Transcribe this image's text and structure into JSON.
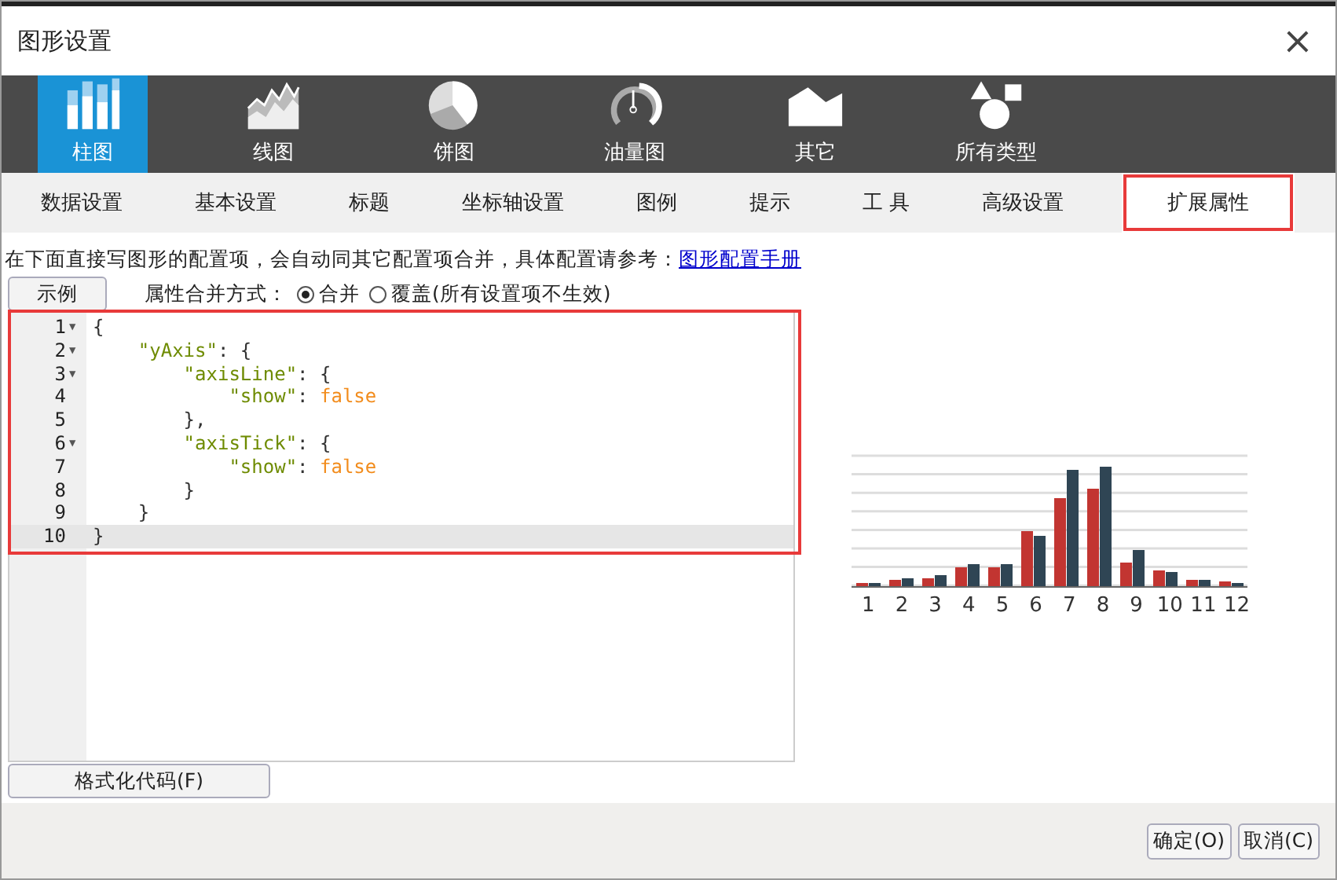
{
  "window": {
    "title": "图形设置",
    "close": "×"
  },
  "chart_types": [
    {
      "label": "柱图",
      "selected": true
    },
    {
      "label": "线图",
      "selected": false
    },
    {
      "label": "饼图",
      "selected": false
    },
    {
      "label": "油量图",
      "selected": false
    },
    {
      "label": "其它",
      "selected": false
    },
    {
      "label": "所有类型",
      "selected": false
    }
  ],
  "tabs": [
    {
      "label": "数据设置",
      "selected": false
    },
    {
      "label": "基本设置",
      "selected": false
    },
    {
      "label": "标题",
      "selected": false
    },
    {
      "label": "坐标轴设置",
      "selected": false
    },
    {
      "label": "图例",
      "selected": false
    },
    {
      "label": "提示",
      "selected": false
    },
    {
      "label": "工 具",
      "selected": false
    },
    {
      "label": "高级设置",
      "selected": false
    },
    {
      "label": "扩展属性",
      "selected": true
    }
  ],
  "hint": {
    "text": "在下面直接写图形的配置项，会自动同其它配置项合并，具体配置请参考：",
    "link": "图形配置手册"
  },
  "example_button": "示例",
  "merge": {
    "label": "属性合并方式：",
    "options": [
      {
        "label": "合并",
        "selected": true
      },
      {
        "label": "覆盖(所有设置项不生效)",
        "selected": false
      }
    ]
  },
  "editor": {
    "lines": [
      {
        "number": "1",
        "fold": "▼",
        "active": false,
        "tokens": [
          {
            "kind": "punct",
            "text": "{"
          }
        ]
      },
      {
        "number": "2",
        "fold": "▼",
        "active": false,
        "tokens": [
          {
            "kind": "key",
            "text": "    \"yAxis\""
          },
          {
            "kind": "punct",
            "text": ": {"
          }
        ]
      },
      {
        "number": "3",
        "fold": "▼",
        "active": false,
        "tokens": [
          {
            "kind": "key",
            "text": "        \"axisLine\""
          },
          {
            "kind": "punct",
            "text": ": {"
          }
        ]
      },
      {
        "number": "4",
        "active": false,
        "tokens": [
          {
            "kind": "key",
            "text": "            \"show\""
          },
          {
            "kind": "punct",
            "text": ": "
          },
          {
            "kind": "bool",
            "text": "false"
          }
        ]
      },
      {
        "number": "5",
        "active": false,
        "tokens": [
          {
            "kind": "punct",
            "text": "        },"
          }
        ]
      },
      {
        "number": "6",
        "fold": "▼",
        "active": false,
        "tokens": [
          {
            "kind": "key",
            "text": "        \"axisTick\""
          },
          {
            "kind": "punct",
            "text": ": {"
          }
        ]
      },
      {
        "number": "7",
        "active": false,
        "tokens": [
          {
            "kind": "key",
            "text": "            \"show\""
          },
          {
            "kind": "punct",
            "text": ": "
          },
          {
            "kind": "bool",
            "text": "false"
          }
        ]
      },
      {
        "number": "8",
        "active": false,
        "tokens": [
          {
            "kind": "punct",
            "text": "        }"
          }
        ]
      },
      {
        "number": "9",
        "active": false,
        "tokens": [
          {
            "kind": "punct",
            "text": "    }"
          }
        ]
      },
      {
        "number": "10",
        "active": true,
        "tokens": [
          {
            "kind": "punct",
            "text": "}"
          }
        ]
      }
    ]
  },
  "preview": {
    "x_labels": [
      "1",
      "2",
      "3",
      "4",
      "5",
      "6",
      "7",
      "8",
      "9",
      "10",
      "11",
      "12"
    ]
  },
  "format_button": "格式化代码(F)",
  "footer": {
    "buttons": [
      "确定(O)",
      "取消(C)"
    ]
  }
}
